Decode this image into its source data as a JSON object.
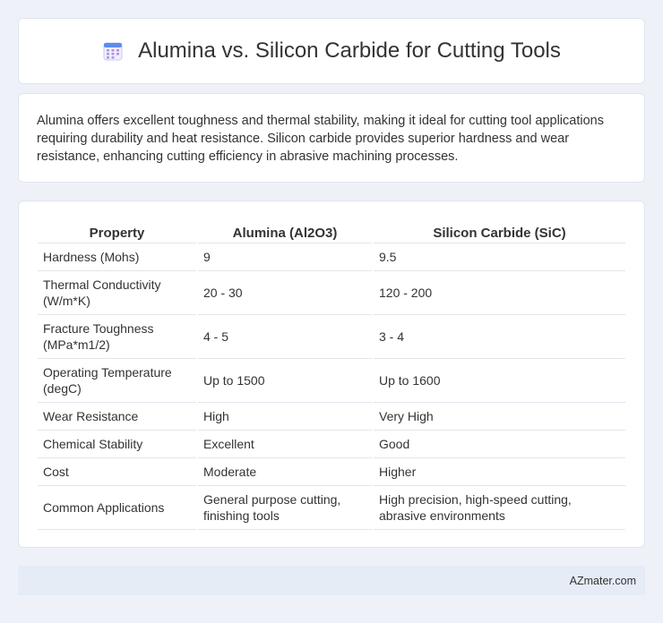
{
  "header": {
    "title": "Alumina vs. Silicon Carbide for Cutting Tools",
    "icon": "calendar-icon"
  },
  "intro": {
    "text": "Alumina offers excellent toughness and thermal stability, making it ideal for cutting tool applications requiring durability and heat resistance. Silicon carbide provides superior hardness and wear resistance, enhancing cutting efficiency in abrasive machining processes."
  },
  "table": {
    "headers": [
      "Property",
      "Alumina (Al2O3)",
      "Silicon Carbide (SiC)"
    ],
    "rows": [
      [
        "Hardness (Mohs)",
        "9",
        "9.5"
      ],
      [
        "Thermal Conductivity (W/m*K)",
        "20 - 30",
        "120 - 200"
      ],
      [
        "Fracture Toughness (MPa*m1/2)",
        "4 - 5",
        "3 - 4"
      ],
      [
        "Operating Temperature (degC)",
        "Up to 1500",
        "Up to 1600"
      ],
      [
        "Wear Resistance",
        "High",
        "Very High"
      ],
      [
        "Chemical Stability",
        "Excellent",
        "Good"
      ],
      [
        "Cost",
        "Moderate",
        "Higher"
      ],
      [
        "Common Applications",
        "General purpose cutting, finishing tools",
        "High precision, high-speed cutting, abrasive environments"
      ]
    ]
  },
  "footer": {
    "text": "AZmater.com"
  },
  "colors": {
    "background": "#eef2f8",
    "card": "#ffffff",
    "footer": "#e6ecf6",
    "icon_accent": "#5b8def"
  }
}
